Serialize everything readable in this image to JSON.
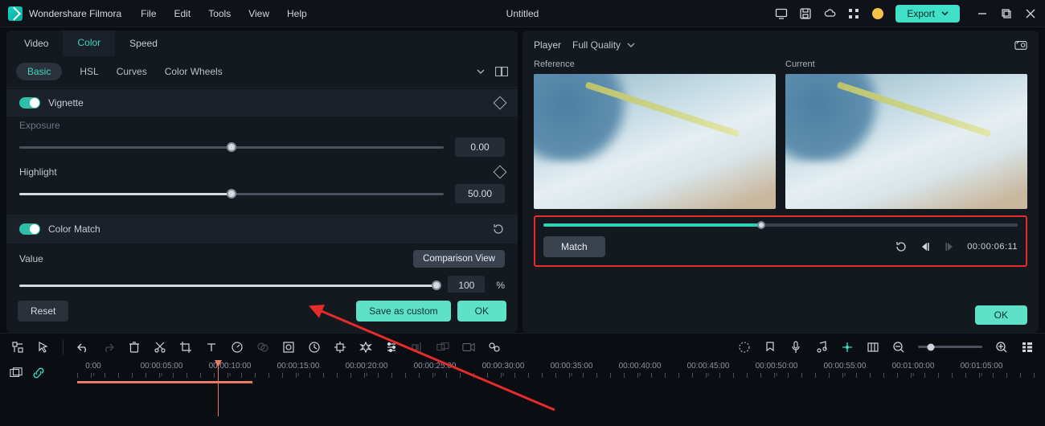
{
  "app": {
    "name": "Wondershare Filmora",
    "document": "Untitled"
  },
  "menu": [
    "File",
    "Edit",
    "Tools",
    "View",
    "Help"
  ],
  "export_label": "Export",
  "left": {
    "tabs": [
      "Video",
      "Color",
      "Speed"
    ],
    "active_tab": 1,
    "subtabs": [
      "Basic",
      "HSL",
      "Curves",
      "Color Wheels"
    ],
    "active_subtab": 0,
    "sections": {
      "vignette": {
        "label": "Vignette"
      },
      "exposure": {
        "label": "Exposure",
        "value": "0.00",
        "pos": 50
      },
      "highlight": {
        "label": "Highlight",
        "value": "50.00",
        "pos": 50
      },
      "colormatch": {
        "label": "Color Match"
      },
      "value": {
        "label": "Value",
        "value": "100",
        "unit": "%",
        "pos": 100,
        "compare": "Comparison View"
      }
    },
    "buttons": {
      "reset": "Reset",
      "save": "Save as custom",
      "ok": "OK"
    }
  },
  "right": {
    "player_label": "Player",
    "quality": "Full Quality",
    "reference_label": "Reference",
    "current_label": "Current",
    "match": "Match",
    "timecode": "00:00:06:11",
    "ok": "OK"
  },
  "timeline": {
    "marks": [
      "0:00",
      "00:00:05:00",
      "00:00:10:00",
      "00:00:15:00",
      "00:00:20:00",
      "00:00:25:00",
      "00:00:30:00",
      "00:00:35:00",
      "00:00:40:00",
      "00:00:45:00",
      "00:00:50:00",
      "00:00:55:00",
      "00:01:00:00",
      "00:01:05:00"
    ]
  }
}
